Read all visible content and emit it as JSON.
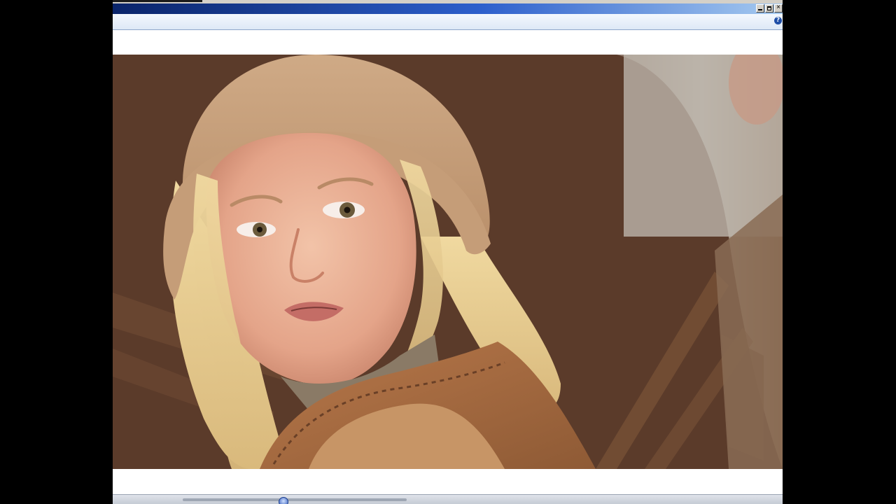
{
  "window": {
    "controls": [
      "minimize",
      "maximize",
      "close"
    ],
    "close_glyph": "×",
    "help_glyph": "?"
  },
  "toolbar": {
    "help_icon": "help-icon"
  },
  "media": {
    "type": "photo",
    "subject": "blonde-girl-knit-hat-sheepskin-vest"
  },
  "player": {
    "progress_fraction": 0.45
  },
  "colors": {
    "titlebar_start": "#0a246a",
    "titlebar_end": "#a6caf0",
    "toolbar_bg": "#dde8f6",
    "letterbox": "#000000"
  }
}
